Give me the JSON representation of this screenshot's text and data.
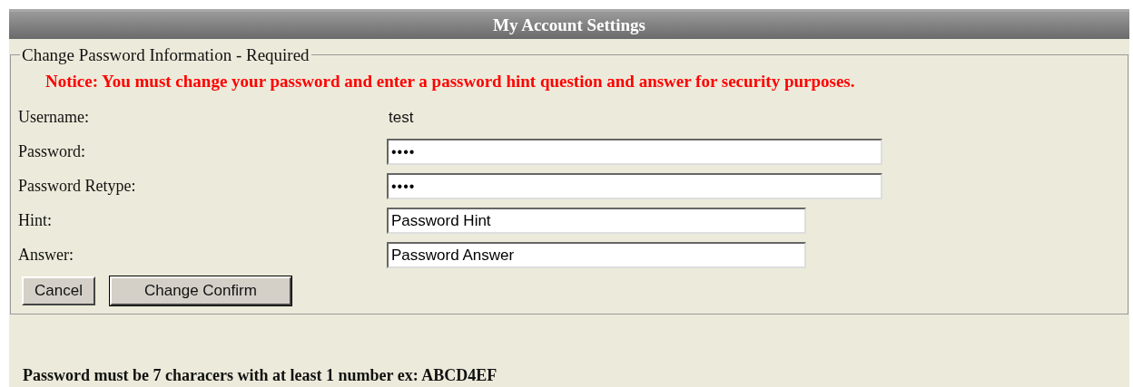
{
  "panel": {
    "title": "My Account Settings"
  },
  "section": {
    "legend": "Change Password Information - Required",
    "notice": "Notice: You must change your password and enter a password hint question and answer for security purposes."
  },
  "fields": [
    {
      "label": "Username:",
      "kind": "static",
      "value": "test"
    },
    {
      "label": "Password:",
      "kind": "masked",
      "value": "••••"
    },
    {
      "label": "Password Retype:",
      "kind": "masked",
      "value": "••••"
    },
    {
      "label": "Hint:",
      "kind": "text",
      "value": "Password Hint"
    },
    {
      "label": "Answer:",
      "kind": "text",
      "value": "Password Answer"
    }
  ],
  "buttons": [
    {
      "label": "Cancel",
      "default": false
    },
    {
      "label": "Change Confirm",
      "default": true
    }
  ],
  "footer_note": "Password must be 7 characers with at least 1 number ex: ABCD4EF"
}
